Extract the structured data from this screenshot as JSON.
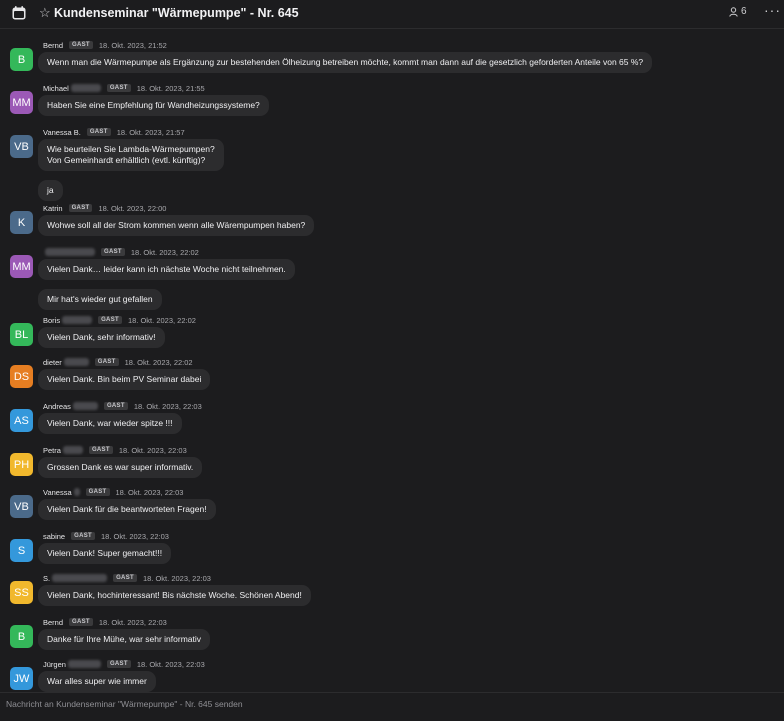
{
  "header": {
    "title": "Kundenseminar \"Wärmepumpe\" - Nr. 645",
    "participant_count": "6",
    "more_label": "···"
  },
  "colors": {
    "background": "#1c1c1e",
    "bubble": "#2c2c2e",
    "avatar_green": "#34b85a",
    "avatar_purple": "#9b59b6",
    "avatar_slate": "#4b6a8a",
    "avatar_orange": "#e67e22",
    "avatar_blue": "#3498db",
    "avatar_yellow": "#f1b82d"
  },
  "messages": [
    {
      "initials": "B",
      "name": "Bernd",
      "badge": "GAST",
      "time": "18. Okt. 2023, 21:52",
      "texts": [
        "Wenn man die Wärmepumpe als Ergänzung zur bestehenden Ölheizung betreiben möchte, kommt man dann auf die gesetzlich geforderten Anteile von 65 %?"
      ]
    },
    {
      "initials": "MM",
      "name": "Michael",
      "badge": "GAST",
      "time": "18. Okt. 2023, 21:55",
      "texts": [
        "Haben Sie eine Empfehlung für Wandheizungssysteme?"
      ]
    },
    {
      "initials": "VB",
      "name": "Vanessa B.",
      "badge": "GAST",
      "time": "18. Okt. 2023, 21:57",
      "texts": [
        "Wie beurteilen Sie Lambda-Wärmepumpen?\nVon Gemeinhardt erhältlich (evtl. künftig)?",
        "ja"
      ]
    },
    {
      "initials": "K",
      "name": "Katrin",
      "badge": "GAST",
      "time": "18. Okt. 2023, 22:00",
      "texts": [
        "Wohwe soll all der Strom kommen wenn alle Wärempumpen haben?"
      ]
    },
    {
      "initials": "MM",
      "name": "",
      "badge": "GAST",
      "time": "18. Okt. 2023, 22:02",
      "texts": [
        "Vielen Dank… leider kann ich nächste Woche nicht teilnehmen.",
        "Mir hat's wieder gut gefallen"
      ]
    },
    {
      "initials": "BL",
      "name": "Boris",
      "badge": "GAST",
      "time": "18. Okt. 2023, 22:02",
      "texts": [
        "Vielen Dank, sehr informativ!"
      ]
    },
    {
      "initials": "DS",
      "name": "dieter",
      "badge": "GAST",
      "time": "18. Okt. 2023, 22:02",
      "texts": [
        "Vielen Dank. Bin beim PV Seminar dabei"
      ]
    },
    {
      "initials": "AS",
      "name": "Andreas",
      "badge": "GAST",
      "time": "18. Okt. 2023, 22:03",
      "texts": [
        "Vielen Dank, war wieder spitze !!!"
      ]
    },
    {
      "initials": "PH",
      "name": "Petra",
      "badge": "GAST",
      "time": "18. Okt. 2023, 22:03",
      "texts": [
        "Grossen Dank es war super informativ."
      ]
    },
    {
      "initials": "VB",
      "name": "Vanessa",
      "badge": "GAST",
      "time": "18. Okt. 2023, 22:03",
      "texts": [
        "Vielen Dank für die beantworteten Fragen!"
      ]
    },
    {
      "initials": "S",
      "name": "sabine",
      "badge": "GAST",
      "time": "18. Okt. 2023, 22:03",
      "texts": [
        "Vielen Dank! Super gemacht!!!"
      ]
    },
    {
      "initials": "SS",
      "name": "S.",
      "badge": "GAST",
      "time": "18. Okt. 2023, 22:03",
      "texts": [
        "Vielen Dank, hochinteressant! Bis nächste Woche. Schönen Abend!"
      ]
    },
    {
      "initials": "B",
      "name": "Bernd",
      "badge": "GAST",
      "time": "18. Okt. 2023, 22:03",
      "texts": [
        "Danke für Ihre Mühe, war sehr informativ"
      ]
    },
    {
      "initials": "JW",
      "name": "Jürgen",
      "badge": "GAST",
      "time": "18. Okt. 2023, 22:03",
      "texts": [
        "War alles super wie immer"
      ]
    }
  ],
  "composer": {
    "placeholder": "Nachricht an Kundenseminar \"Wärmepumpe\" - Nr. 645 senden"
  }
}
